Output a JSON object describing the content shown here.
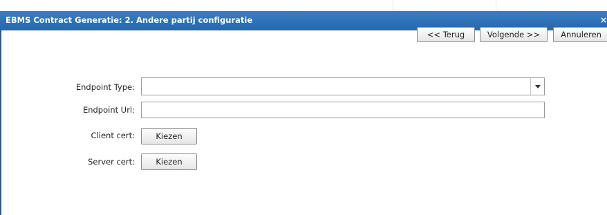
{
  "window": {
    "title": "EBMS Contract Generatie: 2. Andere partij configuratie",
    "close_label": "×"
  },
  "toolbar": {
    "back_label": "<< Terug",
    "next_label": "Volgende >>",
    "cancel_label": "Annuleren"
  },
  "form": {
    "endpoint_type": {
      "label": "Endpoint Type:",
      "value": "",
      "icon": "chevron-down-icon"
    },
    "endpoint_url": {
      "label": "Endpoint Url:",
      "value": "",
      "placeholder": ""
    },
    "client_cert": {
      "label": "Client cert:",
      "button_label": "Kiezen"
    },
    "server_cert": {
      "label": "Server cert:",
      "button_label": "Kiezen"
    }
  },
  "colors": {
    "titlebar": "#2a6db2",
    "title_text": "#ffffff",
    "border": "#1d5e9e"
  }
}
